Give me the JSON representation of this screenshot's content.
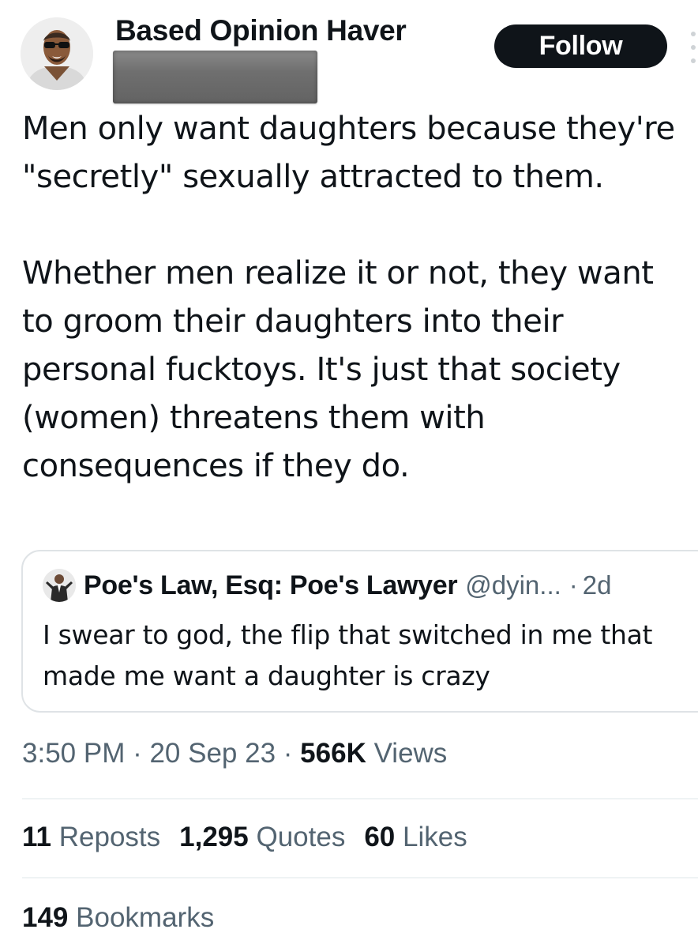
{
  "author": {
    "display_name": "Based Opinion Haver",
    "avatar_icon": "user-avatar-photo",
    "handle_redacted": true
  },
  "follow_button": {
    "label": "Follow"
  },
  "more_icon": "more-options-icon",
  "tweet": {
    "paragraphs": [
      "Men only want daughters because they're \"secretly\" sexually attracted to them.",
      "Whether men realize it or not, they want to groom their daughters into their personal fucktoys. It's just that society (women) threatens them with consequences if they do."
    ]
  },
  "quote": {
    "name": "Poe's Law, Esq: Poe's Lawyer",
    "handle": "@dyin...",
    "separator": "·",
    "age": "2d",
    "text": "I swear to god, the flip that switched in me that made me want a daughter is crazy"
  },
  "meta": {
    "time": "3:50 PM",
    "date": "20 Sep 23",
    "separator": " · ",
    "views_count": "566K",
    "views_label": "Views"
  },
  "stats": {
    "reposts": {
      "count": "11",
      "label": "Reposts"
    },
    "quotes": {
      "count": "1,295",
      "label": "Quotes"
    },
    "likes": {
      "count": "60",
      "label": "Likes"
    },
    "bookmarks": {
      "count": "149",
      "label": "Bookmarks"
    }
  },
  "colors": {
    "text_primary": "#0f1419",
    "text_secondary": "#536471",
    "button_bg": "#0f1419",
    "border": "#dfe3e6"
  }
}
